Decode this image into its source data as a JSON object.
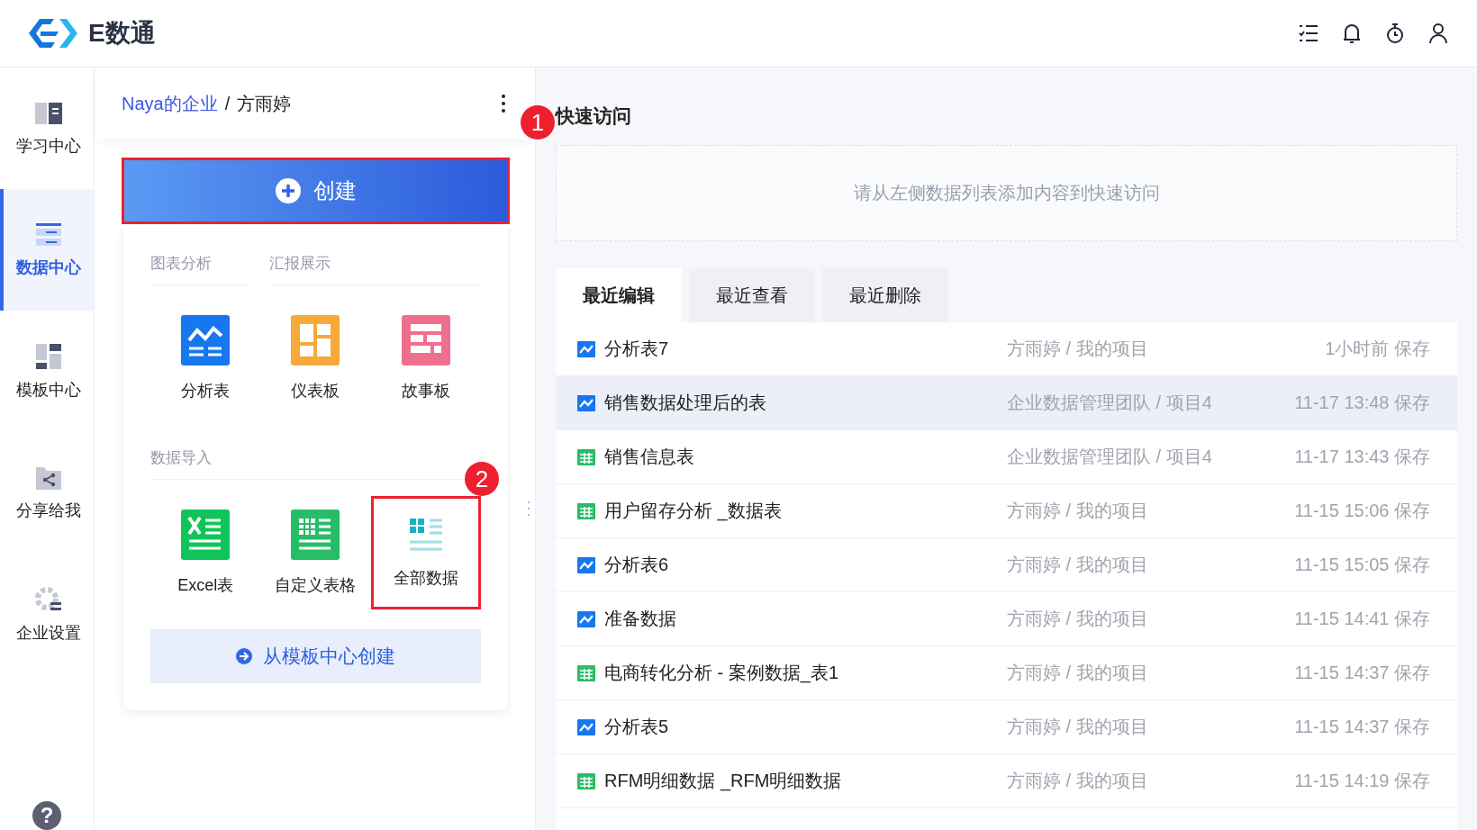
{
  "header": {
    "logo_text": "E数通",
    "actions": [
      {
        "kind": "checklist"
      },
      {
        "kind": "bell"
      },
      {
        "kind": "timer"
      },
      {
        "kind": "user"
      }
    ]
  },
  "nav": {
    "items": [
      {
        "label": "学习中心",
        "kind": "learn",
        "selected": false
      },
      {
        "label": "数据中心",
        "kind": "data",
        "selected": true
      },
      {
        "label": "模板中心",
        "kind": "template",
        "selected": false
      },
      {
        "label": "分享给我",
        "kind": "share",
        "selected": false
      },
      {
        "label": "企业设置",
        "kind": "settings",
        "selected": false
      }
    ],
    "help": "?"
  },
  "panel": {
    "breadcrumb": {
      "org": "Naya的企业",
      "separator": "/",
      "user": "方雨婷"
    },
    "create_button": {
      "label": "创建",
      "highlighted": true,
      "badge": "1"
    },
    "sections": [
      {
        "headers": [
          "图表分析",
          "汇报展示"
        ],
        "items": [
          {
            "label": "分析表",
            "kind": "analysis",
            "highlighted": false
          },
          {
            "label": "仪表板",
            "kind": "dashboard",
            "highlighted": false
          },
          {
            "label": "故事板",
            "kind": "story",
            "highlighted": false
          }
        ]
      },
      {
        "headers": [
          "数据导入"
        ],
        "items": [
          {
            "label": "Excel表",
            "kind": "excel",
            "highlighted": false
          },
          {
            "label": "自定义表格",
            "kind": "custom",
            "highlighted": false
          },
          {
            "label": "全部数据",
            "kind": "all",
            "highlighted": true,
            "badge": "2"
          }
        ]
      }
    ],
    "template_button": "从模板中心创建"
  },
  "quick_access": {
    "title": "快速访问",
    "placeholder": "请从左侧数据列表添加内容到快速访问"
  },
  "tabs": [
    {
      "label": "最近编辑",
      "selected": true
    },
    {
      "label": "最近查看",
      "selected": false
    },
    {
      "label": "最近删除",
      "selected": false
    }
  ],
  "rows": [
    {
      "kind": "analysis",
      "name": "分析表7",
      "location": "方雨婷 / 我的项目",
      "saved": "1小时前 保存",
      "selected": false
    },
    {
      "kind": "analysis",
      "name": "销售数据处理后的表",
      "location": "企业数据管理团队 / 项目4",
      "saved": "11-17 13:48 保存",
      "selected": true
    },
    {
      "kind": "table",
      "name": "销售信息表",
      "location": "企业数据管理团队 / 项目4",
      "saved": "11-17 13:43 保存",
      "selected": false
    },
    {
      "kind": "table",
      "name": "用户留存分析 _数据表",
      "location": "方雨婷 / 我的项目",
      "saved": "11-15 15:06 保存",
      "selected": false
    },
    {
      "kind": "analysis",
      "name": "分析表6",
      "location": "方雨婷 / 我的项目",
      "saved": "11-15 15:05 保存",
      "selected": false
    },
    {
      "kind": "analysis",
      "name": "准备数据",
      "location": "方雨婷 / 我的项目",
      "saved": "11-15 14:41 保存",
      "selected": false
    },
    {
      "kind": "table",
      "name": "电商转化分析 - 案例数据_表1",
      "location": "方雨婷 / 我的项目",
      "saved": "11-15 14:37 保存",
      "selected": false
    },
    {
      "kind": "analysis",
      "name": "分析表5",
      "location": "方雨婷 / 我的项目",
      "saved": "11-15 14:37 保存",
      "selected": false
    },
    {
      "kind": "table",
      "name": "RFM明细数据 _RFM明细数据",
      "location": "方雨婷 / 我的项目",
      "saved": "11-15 14:19 保存",
      "selected": false
    }
  ]
}
